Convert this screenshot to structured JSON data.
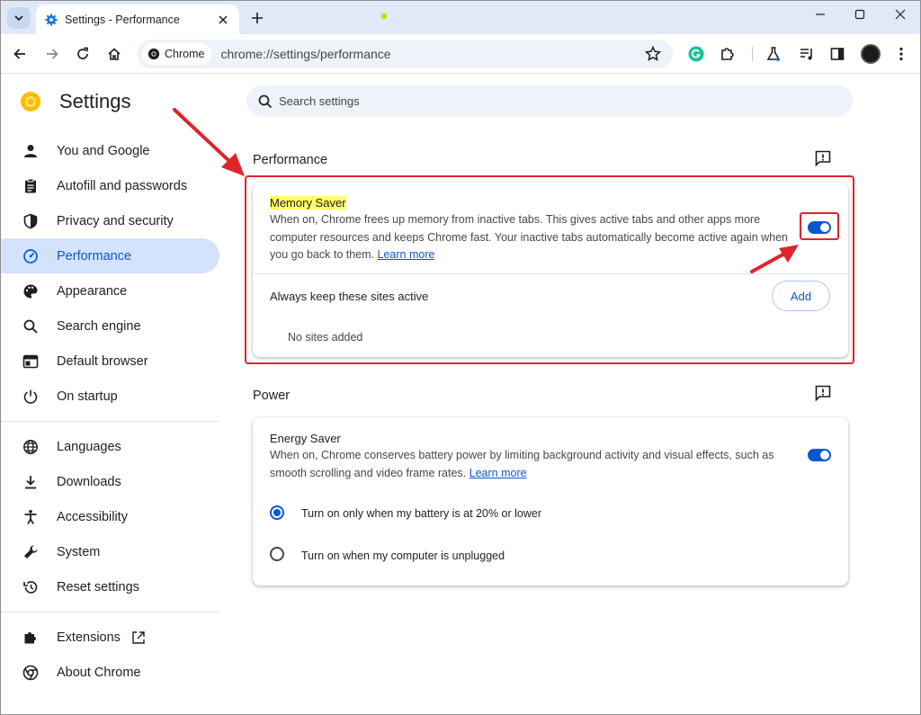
{
  "window": {
    "tab_title": "Settings - Performance",
    "new_tab": "+"
  },
  "toolbar": {
    "chip_label": "Chrome",
    "url": "chrome://settings/performance"
  },
  "sidebar": {
    "app_title": "Settings",
    "items": [
      {
        "label": "You and Google",
        "icon": "person-icon"
      },
      {
        "label": "Autofill and passwords",
        "icon": "clipboard-icon"
      },
      {
        "label": "Privacy and security",
        "icon": "shield-icon"
      },
      {
        "label": "Performance",
        "icon": "speedometer-icon",
        "active": true
      },
      {
        "label": "Appearance",
        "icon": "palette-icon"
      },
      {
        "label": "Search engine",
        "icon": "search-icon"
      },
      {
        "label": "Default browser",
        "icon": "browser-icon"
      },
      {
        "label": "On startup",
        "icon": "power-icon"
      },
      {
        "label": "Languages",
        "icon": "globe-icon"
      },
      {
        "label": "Downloads",
        "icon": "download-icon"
      },
      {
        "label": "Accessibility",
        "icon": "accessibility-icon"
      },
      {
        "label": "System",
        "icon": "wrench-icon"
      },
      {
        "label": "Reset settings",
        "icon": "history-icon"
      },
      {
        "label": "Extensions",
        "icon": "puzzle-icon"
      },
      {
        "label": "About Chrome",
        "icon": "chrome-icon"
      }
    ]
  },
  "search": {
    "placeholder": "Search settings"
  },
  "performance": {
    "section_title": "Performance",
    "memory_saver": {
      "title": "Memory Saver",
      "desc_line1": "When on, Chrome frees up memory from inactive tabs. This gives active tabs and other apps more",
      "desc_line2": "computer resources and keeps Chrome fast. Your inactive tabs automatically become active again when",
      "desc_line3": "you go back to them.",
      "learn_more": "Learn more",
      "enabled": true
    },
    "always_active": {
      "label": "Always keep these sites active",
      "add_button": "Add",
      "empty_text": "No sites added"
    }
  },
  "power": {
    "section_title": "Power",
    "energy_saver": {
      "title": "Energy Saver",
      "desc_line1": "When on, Chrome conserves battery power by limiting background activity and visual effects, such as",
      "desc_line2": "smooth scrolling and video frame rates.",
      "learn_more": "Learn more",
      "enabled": true
    },
    "options": [
      {
        "label": "Turn on only when my battery is at 20% or lower",
        "selected": true
      },
      {
        "label": "Turn on when my computer is unplugged",
        "selected": false
      }
    ]
  },
  "colors": {
    "accent": "#0b57d0",
    "annotation_red": "#e0242c",
    "highlight": "#ffff66"
  }
}
